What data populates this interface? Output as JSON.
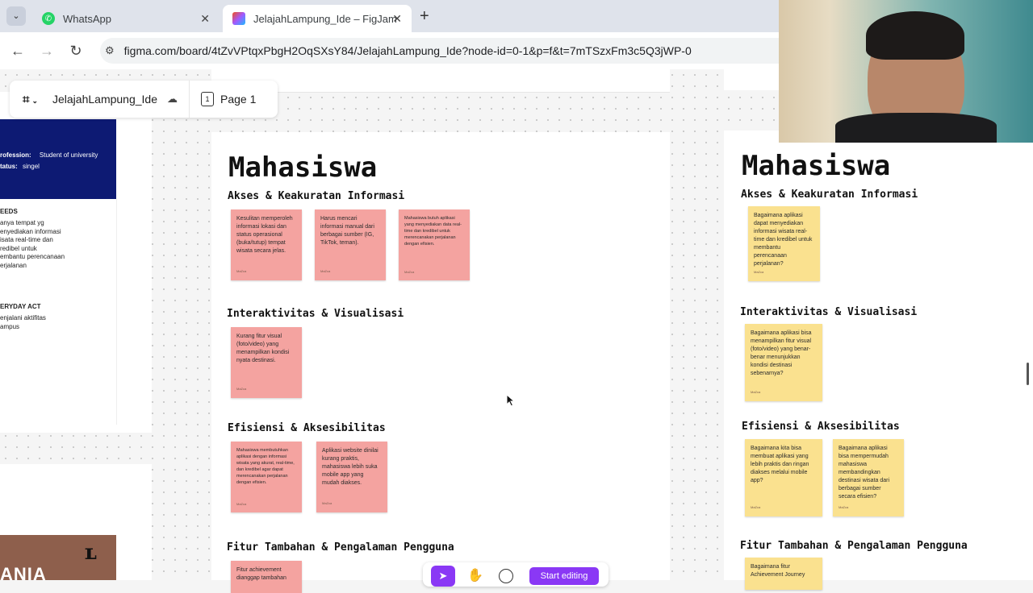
{
  "browser": {
    "tabs": [
      {
        "title": "WhatsApp",
        "active": false
      },
      {
        "title": "JelajahLampung_Ide – FigJam",
        "active": true
      }
    ],
    "new_tab_symbol": "+",
    "url": "figma.com/board/4tZvVPtqxPbgH2OqSXsY84/JelajahLampung_Ide?node-id=0-1&p=f&t=7mTSzxFm3c5Q3jWP-0"
  },
  "figma": {
    "file_name": "JelajahLampung_Ide",
    "page_number": "1",
    "page_label": "Page 1",
    "start_editing": "Start editing"
  },
  "persona": {
    "profession_label": "rofession:",
    "profession_value": "Student of university",
    "status_label": "tatus:",
    "status_value": "singel",
    "needs_title": "EEDS",
    "needs_lines": [
      "anya tempat yg",
      "enyediakan informasi",
      "isata real-time dan",
      "redibel untuk",
      "embantu perencanaan",
      "erjalanan"
    ],
    "everyday_title": "ERYDAY ACT",
    "everyday_lines": [
      "enjalani aktifitas",
      "ampus"
    ],
    "brand_text": "ANIA"
  },
  "left_board": {
    "title": "Mahasiswa",
    "sections": [
      {
        "heading": "Akses & Keakuratan Informasi",
        "notes": [
          {
            "text": "Kesulitan memperoleh informasi lokasi dan status operasional (buka/tutup) tempat wisata secara jelas.",
            "author": "MaZca"
          },
          {
            "text": "Harus mencari informasi manual dari berbagai sumber (IG, TikTok, teman).",
            "author": "MaZca"
          },
          {
            "text": "Mahasiswa butuh aplikasi yang menyediakan data real-time dan kredibel untuk merencanakan perjalanan dengan efisien.",
            "author": "MaZca"
          }
        ]
      },
      {
        "heading": "Interaktivitas & Visualisasi",
        "notes": [
          {
            "text": "Kurang fitur visual (foto/video) yang menampilkan kondisi nyata destinasi.",
            "author": "MaZca"
          }
        ]
      },
      {
        "heading": "Efisiensi & Aksesibilitas",
        "notes": [
          {
            "text": "Mahasiswa membutuhkan aplikasi dengan informasi wisata yang akurat, real-time, dan kredibel agar dapat merencanakan perjalanan dengan efisien.",
            "author": "MaZca"
          },
          {
            "text": "Aplikasi website dinilai kurang praktis, mahasiswa lebih suka mobile app yang mudah diakses.",
            "author": "MaZca"
          }
        ]
      },
      {
        "heading": "Fitur Tambahan & Pengalaman Pengguna",
        "notes": [
          {
            "text": "Fitur achievement dianggap tambahan",
            "author": ""
          }
        ]
      }
    ]
  },
  "right_board": {
    "title": "Mahasiswa",
    "sections": [
      {
        "heading": "Akses & Keakuratan Informasi",
        "notes": [
          {
            "text": "Bagaimana aplikasi dapat menyediakan informasi wisata real-time dan kredibel untuk membantu perencanaan perjalanan?",
            "author": "MaZca"
          }
        ]
      },
      {
        "heading": "Interaktivitas & Visualisasi",
        "notes": [
          {
            "text": "Bagaimana aplikasi bisa menampilkan fitur visual (foto/video) yang benar-benar menunjukkan kondisi destinasi sebenarnya?",
            "author": "MaZca"
          }
        ]
      },
      {
        "heading": "Efisiensi & Aksesibilitas",
        "notes": [
          {
            "text": "Bagaimana kita bisa membuat aplikasi yang lebih praktis dan ringan diakses melalui mobile app?",
            "author": "MaZca"
          },
          {
            "text": "Bagaimana aplikasi bisa mempermudah mahasiswa membandingkan destinasi wisata dari berbagai sumber secara efisien?",
            "author": "MaZca"
          }
        ]
      },
      {
        "heading": "Fitur Tambahan & Pengalaman Pengguna",
        "notes": [
          {
            "text": "Bagaimana fitur Achievement Journey",
            "author": ""
          }
        ]
      }
    ]
  },
  "colors": {
    "pink_note": "#f4a3a0",
    "yellow_note": "#fae18f",
    "persona_navy": "#0d1a73",
    "figma_purple": "#8a38f5"
  },
  "icons": [
    "whatsapp-icon",
    "figma-icon",
    "close-icon",
    "plus-icon",
    "back-icon",
    "forward-icon",
    "reload-icon",
    "site-settings-icon",
    "cloud-icon",
    "page-icon",
    "cursor-icon",
    "hand-icon",
    "comment-icon"
  ]
}
